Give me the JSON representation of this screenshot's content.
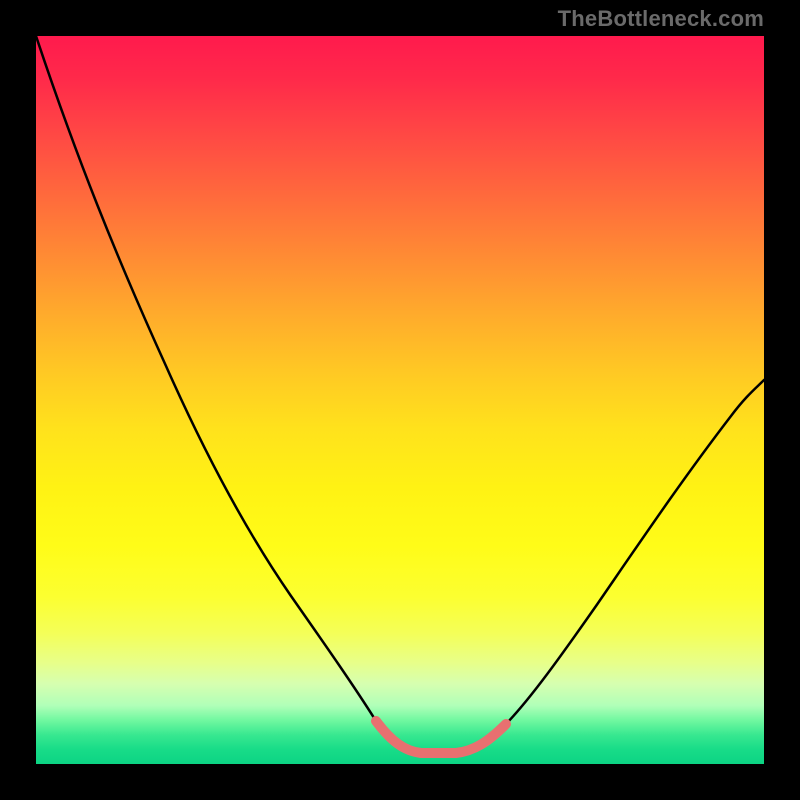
{
  "watermark": {
    "text": "TheBottleneck.com"
  },
  "colors": {
    "frame": "#000000",
    "curve": "#000000",
    "highlight": "#e87070",
    "gradient_top": "#ff1a4d",
    "gradient_bottom": "#0cd484"
  },
  "chart_data": {
    "type": "line",
    "title": "",
    "xlabel": "",
    "ylabel": "",
    "xlim_fraction": [
      0,
      1
    ],
    "ylim_fraction": [
      0,
      1
    ],
    "note": "Axes are untitled and relative; x and y are fractional positions in the plot area (0 = left/top of plot, 1 = right/bottom). y represents distance from top, so higher y = lower in image. Curve is a V-shaped bottleneck curve: steep descent from top-left, flat minimum near the bottom center, then rise toward the right. The lowermost portion of the curve is highlighted with a thicker warm stroke.",
    "series": [
      {
        "name": "bottleneck-curve",
        "x": [
          0.0,
          0.03,
          0.07,
          0.12,
          0.17,
          0.22,
          0.27,
          0.32,
          0.37,
          0.42,
          0.46,
          0.5,
          0.53,
          0.55,
          0.58,
          0.62,
          0.65,
          0.7,
          0.76,
          0.82,
          0.88,
          0.94,
          1.0
        ],
        "y": [
          0.0,
          0.1,
          0.2,
          0.32,
          0.44,
          0.55,
          0.66,
          0.76,
          0.84,
          0.91,
          0.955,
          0.975,
          0.985,
          0.985,
          0.985,
          0.975,
          0.955,
          0.91,
          0.85,
          0.78,
          0.69,
          0.585,
          0.47
        ]
      }
    ],
    "highlight_segment": {
      "description": "thicker light-red stroke over the flat bottom of the curve",
      "x": [
        0.46,
        0.5,
        0.53,
        0.55,
        0.58,
        0.62,
        0.65
      ],
      "y": [
        0.955,
        0.975,
        0.985,
        0.985,
        0.985,
        0.975,
        0.955
      ]
    }
  }
}
